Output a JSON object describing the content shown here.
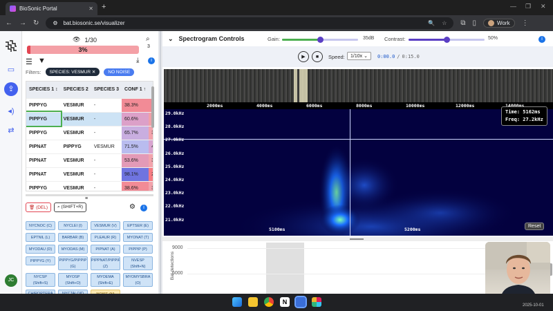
{
  "browser": {
    "tab_title": "BioSonic Portal",
    "url": "bat.biosonic.se/visualizer",
    "profile": "Work",
    "new_tab": "+"
  },
  "rail": {
    "icons": [
      "logo-icon",
      "window-icon",
      "upload-icon",
      "audio-wave-icon",
      "flow-icon"
    ],
    "avatar": "JC"
  },
  "left": {
    "pager": "1/30",
    "search_count": "3",
    "progress_text": "3%",
    "progress_value": 0.03,
    "filters_label": "Filters:",
    "filter_chips": [
      "SPECIES: VESMUR",
      "NO NOISE"
    ],
    "table": {
      "headers": [
        "SPECIES 1 ↕",
        "SPECIES 2",
        "SPECIES 3",
        "CONF 1 ↑",
        "CO"
      ],
      "rows": [
        {
          "s1": "PIPPYG",
          "s2": "VESMUR",
          "s3": "-",
          "c1": "38.3%",
          "c2": "37",
          "c1color": "#f28b96",
          "c2color": "#f28b96"
        },
        {
          "s1": "PIPPYG",
          "s2": "VESMUR",
          "s3": "-",
          "c1": "60.6%",
          "c2": "36.",
          "c1color": "#dca0c8",
          "c2color": "#f1a0a8"
        },
        {
          "s1": "PIPPYG",
          "s2": "VESMUR",
          "s3": "-",
          "c1": "65.7%",
          "c2": "36.",
          "c1color": "#c9aee0",
          "c2color": "#f2a3ac"
        },
        {
          "s1": "PIPNAT",
          "s2": "PIPPYG",
          "s3": "VESMUR",
          "c1": "71.5%",
          "c2": "42.",
          "c1color": "#b9bcef",
          "c2color": "#d8a4d0"
        },
        {
          "s1": "PIPNAT",
          "s2": "VESMUR",
          "s3": "-",
          "c1": "53.6%",
          "c2": "36.",
          "c1color": "#e39ab7",
          "c2color": "#f2a3ac"
        },
        {
          "s1": "PIPNAT",
          "s2": "VESMUR",
          "s3": "-",
          "c1": "98.1%",
          "c2": "21.",
          "c1color": "#6f74e0",
          "c2color": "#f57b82"
        },
        {
          "s1": "PIPPYG",
          "s2": "VESMUR",
          "s3": "-",
          "c1": "38.6%",
          "c2": "36.",
          "c1color": "#f28b96",
          "c2color": "#f2a3ac"
        }
      ]
    },
    "del_label": "(DEL)",
    "shift_label": "(SHIFT+R)",
    "species_buttons": [
      "NYCNOC (C)",
      "NYCLEI (I)",
      "VESMUR (V)",
      "EPTSER (E)",
      "EPTNIL (L)",
      "BARBAR (B)",
      "PLEAUR (R)",
      "MYONAT (T)",
      "MYODAU (D)",
      "MYODAS (M)",
      "PIPNAT (A)",
      "PIPPIP (P)",
      "PIPPYG (Y)",
      "PIPPYG/PIPPIP (G)",
      "PIPPNAT/PIPPIP (Z)",
      "NVESP (Shift+N)",
      "NYCSP (Shift+S)",
      "MYOSP (Shift+O)",
      "MYOEMA (Shift+E)",
      "MYOMYSBRA (O)",
      "CHIROPTERA (Q)",
      "NYCTALOID (Shift+P)",
      "NOISE (N)"
    ]
  },
  "right": {
    "title": "Spectrogram Controls",
    "gain_label": "Gain:",
    "gain_value": "35dB",
    "gain_fraction": 0.5,
    "contrast_label": "Contrast:",
    "contrast_value": "50%",
    "contrast_fraction": 0.5,
    "speed_label": "Speed:",
    "speed_value": "1/10x",
    "time_current": "0:00.0",
    "time_sep": "/",
    "time_total": "0:15.0",
    "ruler_ticks": [
      "2000ms",
      "4000ms",
      "6000ms",
      "8000ms",
      "10000ms",
      "12000ms",
      "14000ms"
    ],
    "freq_ticks": [
      "29.0kHz",
      "28.0kHz",
      "27.0kHz",
      "26.0kHz",
      "25.0kHz",
      "24.0kHz",
      "23.0kHz",
      "22.0kHz",
      "21.0kHz"
    ],
    "time_ticks": [
      "5100ms",
      "5200ms"
    ],
    "readout_time": "Time: 5162ms",
    "readout_freq": "Freq: 27.2kHz",
    "reset_label": "Reset",
    "bottom_y_label": "Bat detections",
    "bottom_ticks": [
      "9000",
      "6000"
    ]
  },
  "taskbar": {
    "date": "2025-10-01"
  }
}
